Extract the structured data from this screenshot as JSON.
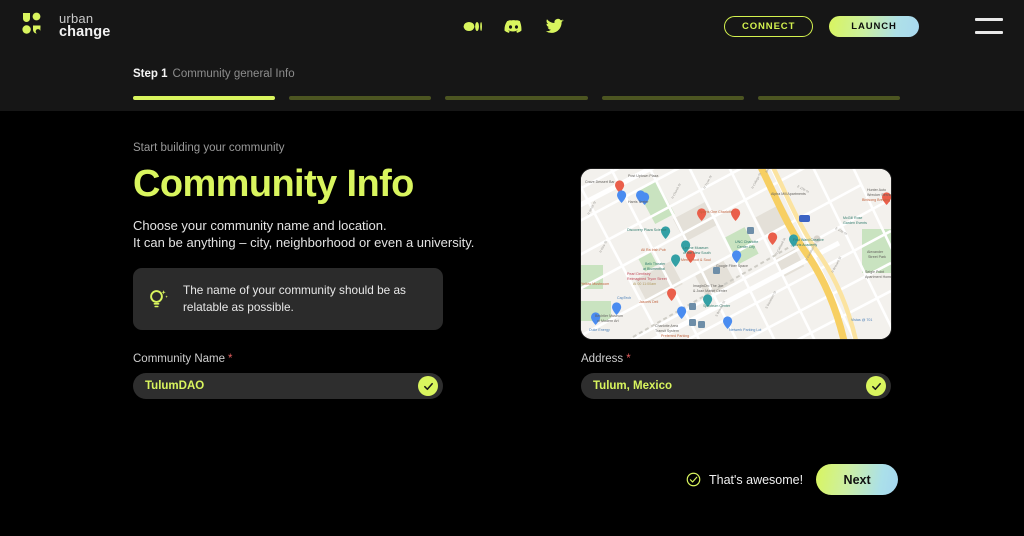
{
  "brand": {
    "name_line1": "urban",
    "name_line2": "change",
    "logo_color": "#d9f55e"
  },
  "header": {
    "socials": [
      {
        "name": "medium-icon",
        "label": "Medium"
      },
      {
        "name": "discord-icon",
        "label": "Discord"
      },
      {
        "name": "twitter-icon",
        "label": "Twitter"
      }
    ],
    "connect_label": "CONNECT",
    "launch_label": "LAUNCH",
    "menu_label": "Menu"
  },
  "stepper": {
    "step_number": "Step 1",
    "step_title": "Community general Info",
    "total_steps": 5,
    "active_step": 1,
    "active_color": "#d9f55e",
    "inactive_color": "#4c5521"
  },
  "main": {
    "eyebrow": "Start building your community",
    "title": "Community Info",
    "subtitle_line1": "Choose your community name and location.",
    "subtitle_line2": "It can be anything – city, neighborhood or even a university.",
    "tip": {
      "icon": "lightbulb-icon",
      "text": "The name of your community should be as relatable as possible."
    }
  },
  "form": {
    "community_name": {
      "label": "Community Name",
      "required_mark": "*",
      "value": "TulumDAO",
      "placeholder": "Community Name",
      "validated": true
    },
    "address": {
      "label": "Address",
      "required_mark": "*",
      "value": "Tulum, Mexico",
      "placeholder": "Address",
      "validated": true
    }
  },
  "map": {
    "name": "location-preview-map",
    "labels": [
      "Post Uptown Plaza",
      "Crave Dessert Bar",
      "Harris Teeter",
      "Discovery Place Science",
      "Sports One Charlotte",
      "Alpha Mill Apartments",
      "Hunter Auto Wrecker Service",
      "Birdsong Brewing Co",
      "McGill Rose Garden Events",
      "UNC Charlotte Center City",
      "First Ward Creative Arts Academy",
      "Alexander Street Park",
      "Levine Museum of the New South",
      "All Ra Irish Pub",
      "Men's Hair & Soul",
      "Google Fiber Space",
      "Belk Theater at Blumenthal",
      "Pearl Dentistry Reimagined Tryon Street",
      "Seigle Point Apartment Homes",
      "Yellow Mushroom",
      "ImaginOn: The Joe & Joan Martin Center",
      "CapTech",
      "Jason's Deli",
      "Spectrum Center",
      "Bechtler Museum of Modern Art",
      "Duke Energy",
      "Charlotte Area Transit System",
      "Preferred Parking",
      "Netwerk Parking Lot",
      "Vistas @ 701"
    ]
  },
  "footer": {
    "confirmation_text": "That's awesome!",
    "confirmation_icon": "check-circle-icon",
    "next_label": "Next"
  }
}
